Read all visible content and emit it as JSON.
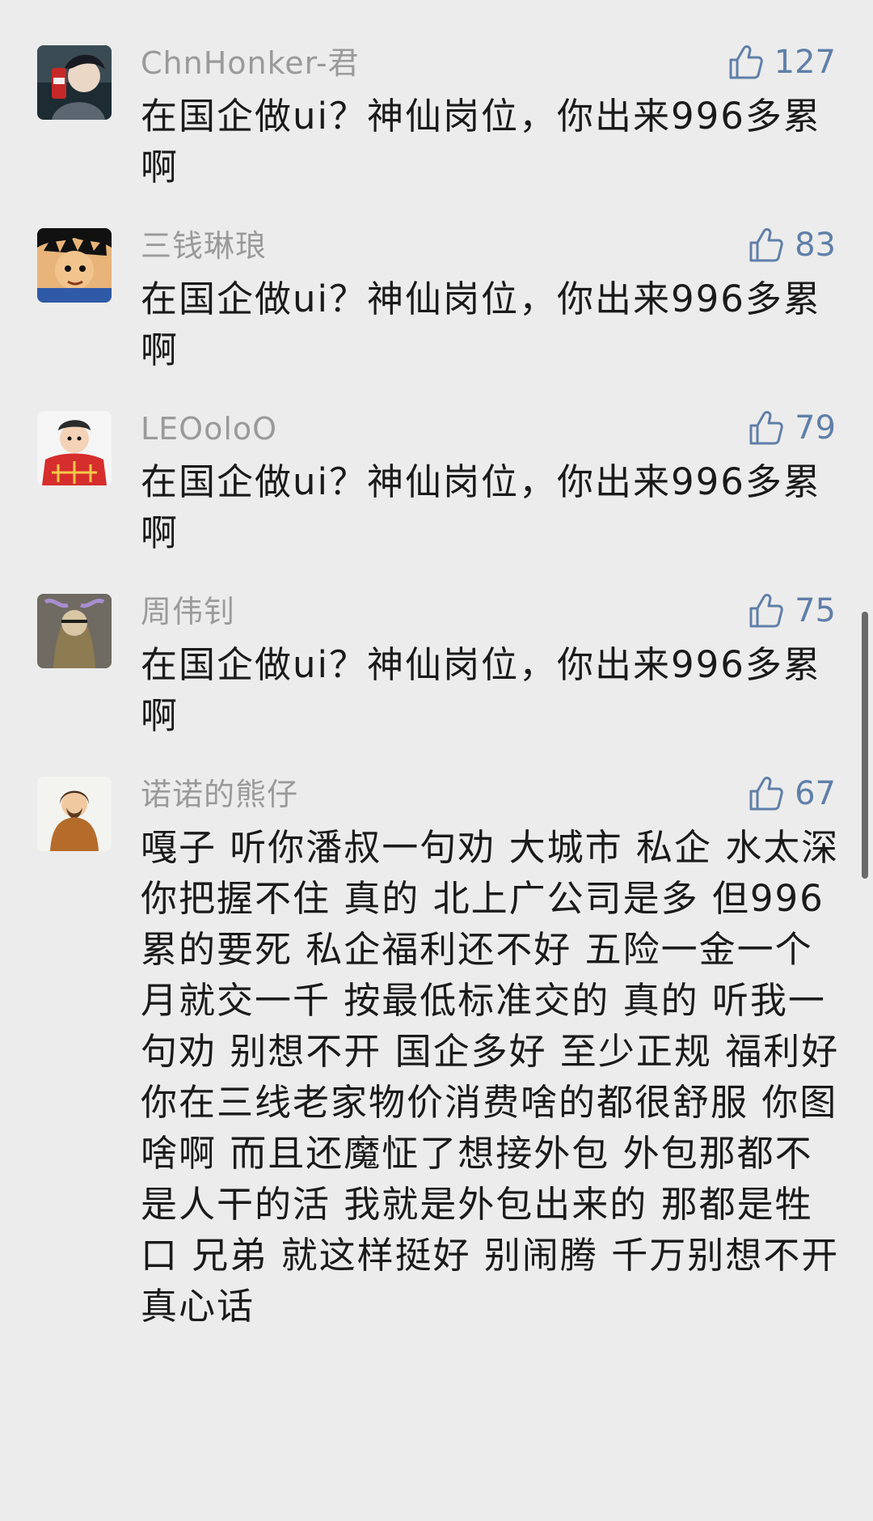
{
  "comments": [
    {
      "username": "ChnHonker-君",
      "likes": "127",
      "text": "在国企做ui？神仙岗位，你出来996多累啊",
      "avatar_icon": "avatar-anime-cola"
    },
    {
      "username": "三钱琳琅",
      "likes": "83",
      "text": "在国企做ui？神仙岗位，你出来996多累啊",
      "avatar_icon": "avatar-cartoon-boy"
    },
    {
      "username": "LEOoloO",
      "likes": "79",
      "text": "在国企做ui？神仙岗位，你出来996多累啊",
      "avatar_icon": "avatar-cartoon-red-fan"
    },
    {
      "username": "周伟钊",
      "likes": "75",
      "text": "在国企做ui？神仙岗位，你出来996多累啊",
      "avatar_icon": "avatar-masked-figure"
    },
    {
      "username": "诺诺的熊仔",
      "likes": "67",
      "text": "嘎子 听你潘叔一句劝 大城市 私企 水太深 你把握不住 真的 北上广公司是多 但996累的要死 私企福利还不好 五险一金一个月就交一千 按最低标准交的 真的 听我一句劝 别想不开 国企多好 至少正规 福利好 你在三线老家物价消费啥的都很舒服 你图啥啊 而且还魔怔了想接外包 外包那都不是人干的活 我就是外包出来的 那都是牲口 兄弟 就这样挺好 别闹腾 千万别想不开 真心话",
      "avatar_icon": "avatar-bear-portrait"
    }
  ],
  "colors": {
    "background": "#ececec",
    "username": "#9a9a9a",
    "like_accent": "#5f7fa8",
    "text": "#1a1a1a"
  },
  "icons": {
    "like": "thumbs-up-icon"
  }
}
